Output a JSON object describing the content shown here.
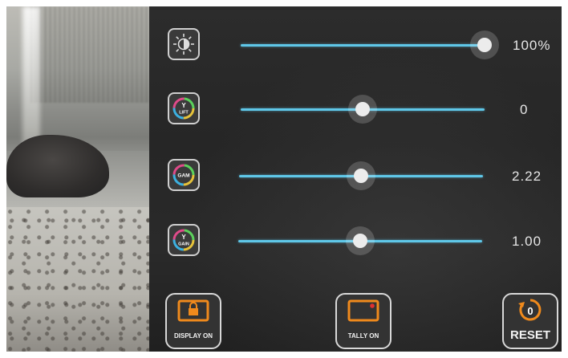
{
  "sliders": [
    {
      "id": "brightness",
      "icon": "brightness-icon",
      "level": 1.0,
      "value": "100%"
    },
    {
      "id": "lift",
      "icon": "y-lift-icon",
      "icon_text": "Y",
      "icon_sub": "LIFT",
      "level": 0.5,
      "value": "0"
    },
    {
      "id": "gamma",
      "icon": "gamma-icon",
      "icon_text": "GAM",
      "level": 0.5,
      "value": "2.22"
    },
    {
      "id": "gain",
      "icon": "y-gain-icon",
      "icon_text": "Y",
      "icon_sub": "GAIN",
      "level": 0.5,
      "value": "1.00"
    }
  ],
  "buttons": {
    "display": {
      "icon": "display-lock-icon",
      "label": "DISPLAY ON"
    },
    "tally": {
      "icon": "tally-icon",
      "label": "TALLY ON"
    },
    "reset": {
      "icon": "reset-icon",
      "icon_text": "0",
      "label": "RESET"
    }
  },
  "colors": {
    "accent": "#5fc7e8",
    "tally_dot": "#e03030",
    "button_orange": "#f08a1c"
  }
}
